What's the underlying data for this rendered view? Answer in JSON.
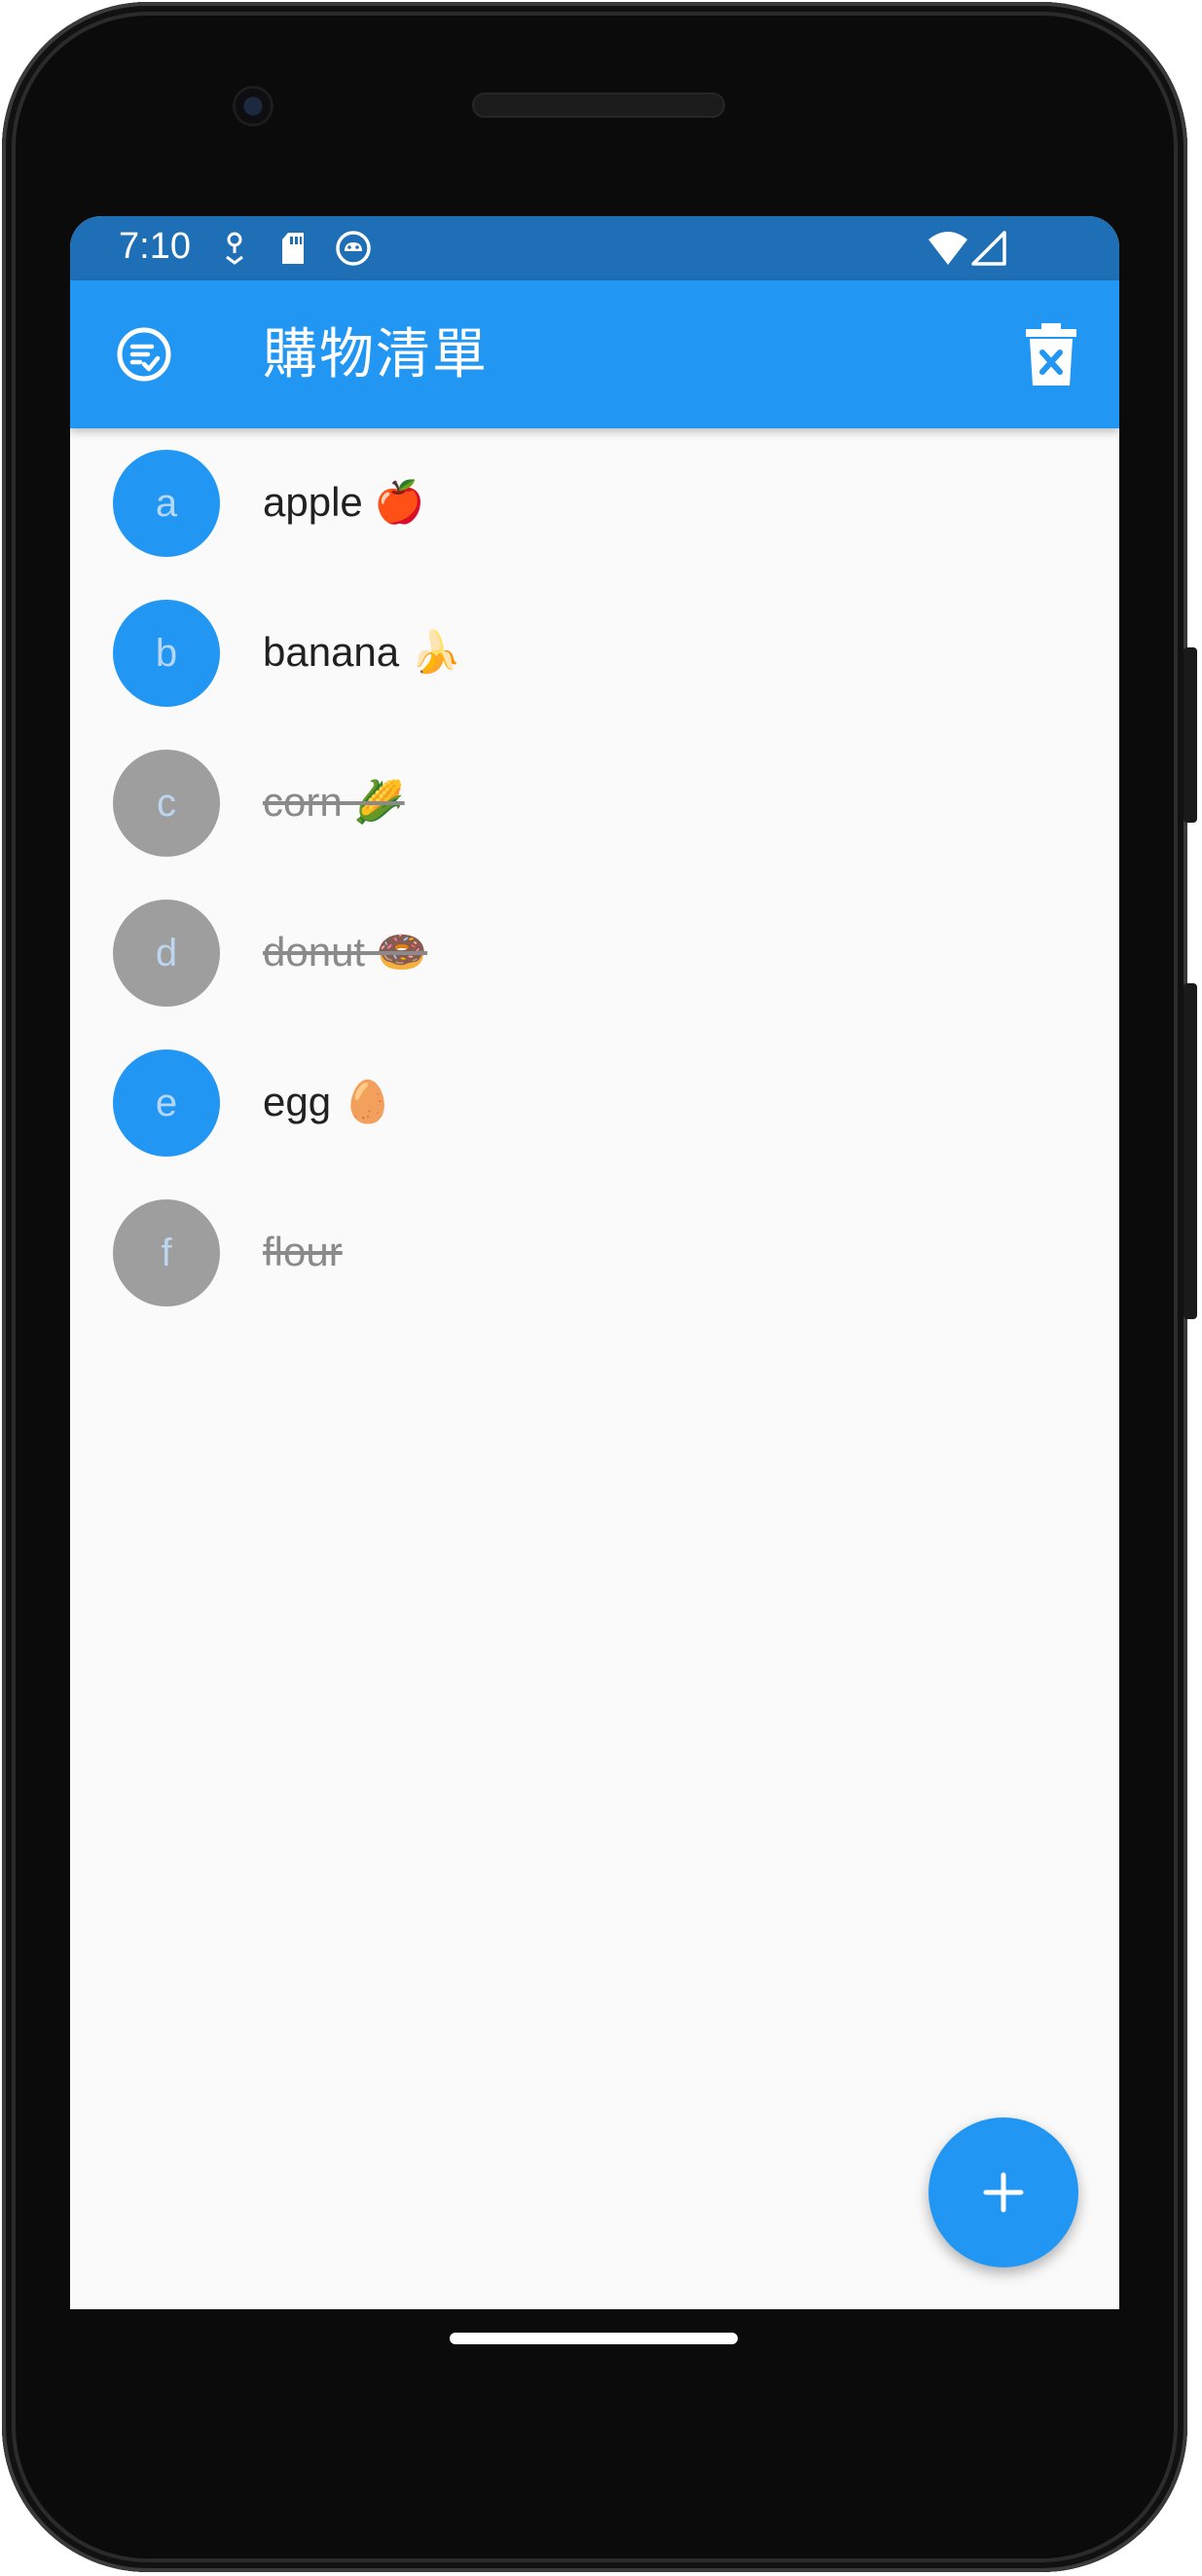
{
  "status_bar": {
    "time": "7:10",
    "icons": [
      "gps-icon",
      "sd-card-icon",
      "app-notification-icon",
      "wifi-icon",
      "signal-icon"
    ]
  },
  "app_bar": {
    "title": "購物清單",
    "leading_icon": "checklist-icon",
    "action_icon": "delete-sweep-icon"
  },
  "items": [
    {
      "letter": "a",
      "label": "apple 🍎",
      "done": false
    },
    {
      "letter": "b",
      "label": "banana 🍌",
      "done": false
    },
    {
      "letter": "c",
      "label": "corn 🌽",
      "done": true
    },
    {
      "letter": "d",
      "label": "donut 🍩",
      "done": true
    },
    {
      "letter": "e",
      "label": "egg 🥚",
      "done": false
    },
    {
      "letter": "f",
      "label": "flour",
      "done": true
    }
  ],
  "fab": {
    "icon": "plus-icon"
  },
  "colors": {
    "primary": "#2196f3",
    "status_bar": "#1e6fb5",
    "done_avatar": "#9e9e9e",
    "background": "#fafafa"
  }
}
